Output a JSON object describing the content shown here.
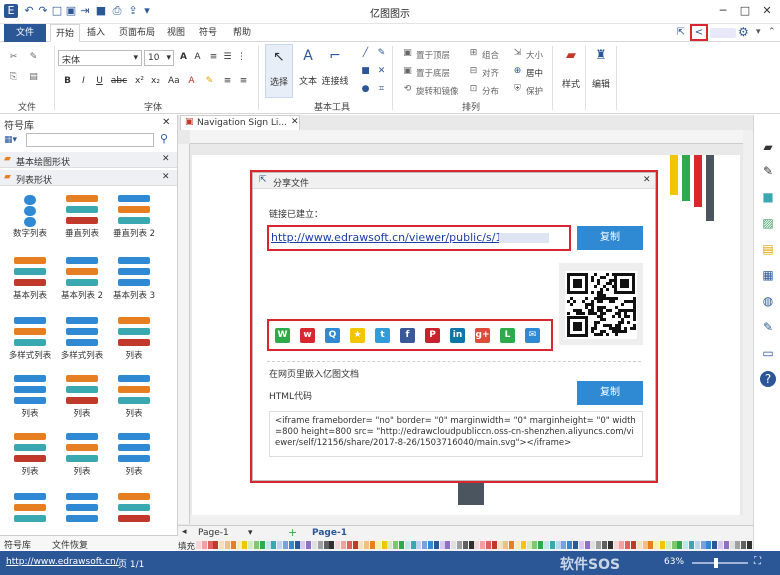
{
  "window": {
    "title": "亿图图示"
  },
  "tabs": {
    "file": "文件",
    "items": [
      "开始",
      "插入",
      "页面布局",
      "视图",
      "符号",
      "帮助"
    ]
  },
  "ribbon": {
    "font_name": "宋体",
    "font_size": "10",
    "groups": {
      "file": "文件",
      "font": "字体",
      "basic_tools": "基本工具",
      "arrange": "排列"
    },
    "tools": {
      "select": "选择",
      "text": "文本",
      "connector": "连接线",
      "style": "样式",
      "edit": "编辑"
    },
    "arrange": {
      "bring_front": "置于顶层",
      "send_back": "置于底层",
      "rotate": "旋转和镜像",
      "group": "组合",
      "align": "对齐",
      "distribute": "分布",
      "size": "大小",
      "center": "居中",
      "protect": "保护"
    },
    "bold": "B",
    "italic": "I",
    "underline": "U",
    "abc": "abc"
  },
  "library": {
    "title": "符号库",
    "search_placeholder": "",
    "sections": [
      "基本绘图形状",
      "列表形状"
    ],
    "items": [
      "数字列表",
      "垂直列表",
      "垂直列表 2",
      "基本列表",
      "基本列表 2",
      "基本列表 3",
      "多样式列表",
      "多样式列表",
      "列表",
      "列表",
      "列表",
      "列表",
      "列表",
      "列表",
      "列表"
    ],
    "bottom_tabs": [
      "符号库",
      "文件恢复"
    ]
  },
  "document": {
    "tab_title": "Navigation Sign Li..."
  },
  "dialog": {
    "title": "分享文件",
    "link_created": "链接已建立：",
    "url": "http://www.edrawsoft.cn/viewer/public/s/118f97",
    "copy1": "复制",
    "embed_title": "在网页里嵌入亿图文档",
    "html_label": "HTML代码",
    "copy2": "复制",
    "code": "<iframe frameborder= \"no\" border= \"0\" marginwidth= \"0\" marginheight= \"0\" width=800 height=800 src= \"http://edrawcloudpubliccn.oss-cn-shenzhen.aliyuncs.com/viewer/self/12156/share/2017-8-26/1503716040/main.svg\"></iframe>"
  },
  "page_tabs": {
    "left": "Page-1",
    "active": "Page-1"
  },
  "palette": {
    "label": "填充"
  },
  "status": {
    "url": "http://www.edrawsoft.cn/",
    "page": "页 1/1",
    "zoom": "63%",
    "watermark": "软件SOS"
  }
}
